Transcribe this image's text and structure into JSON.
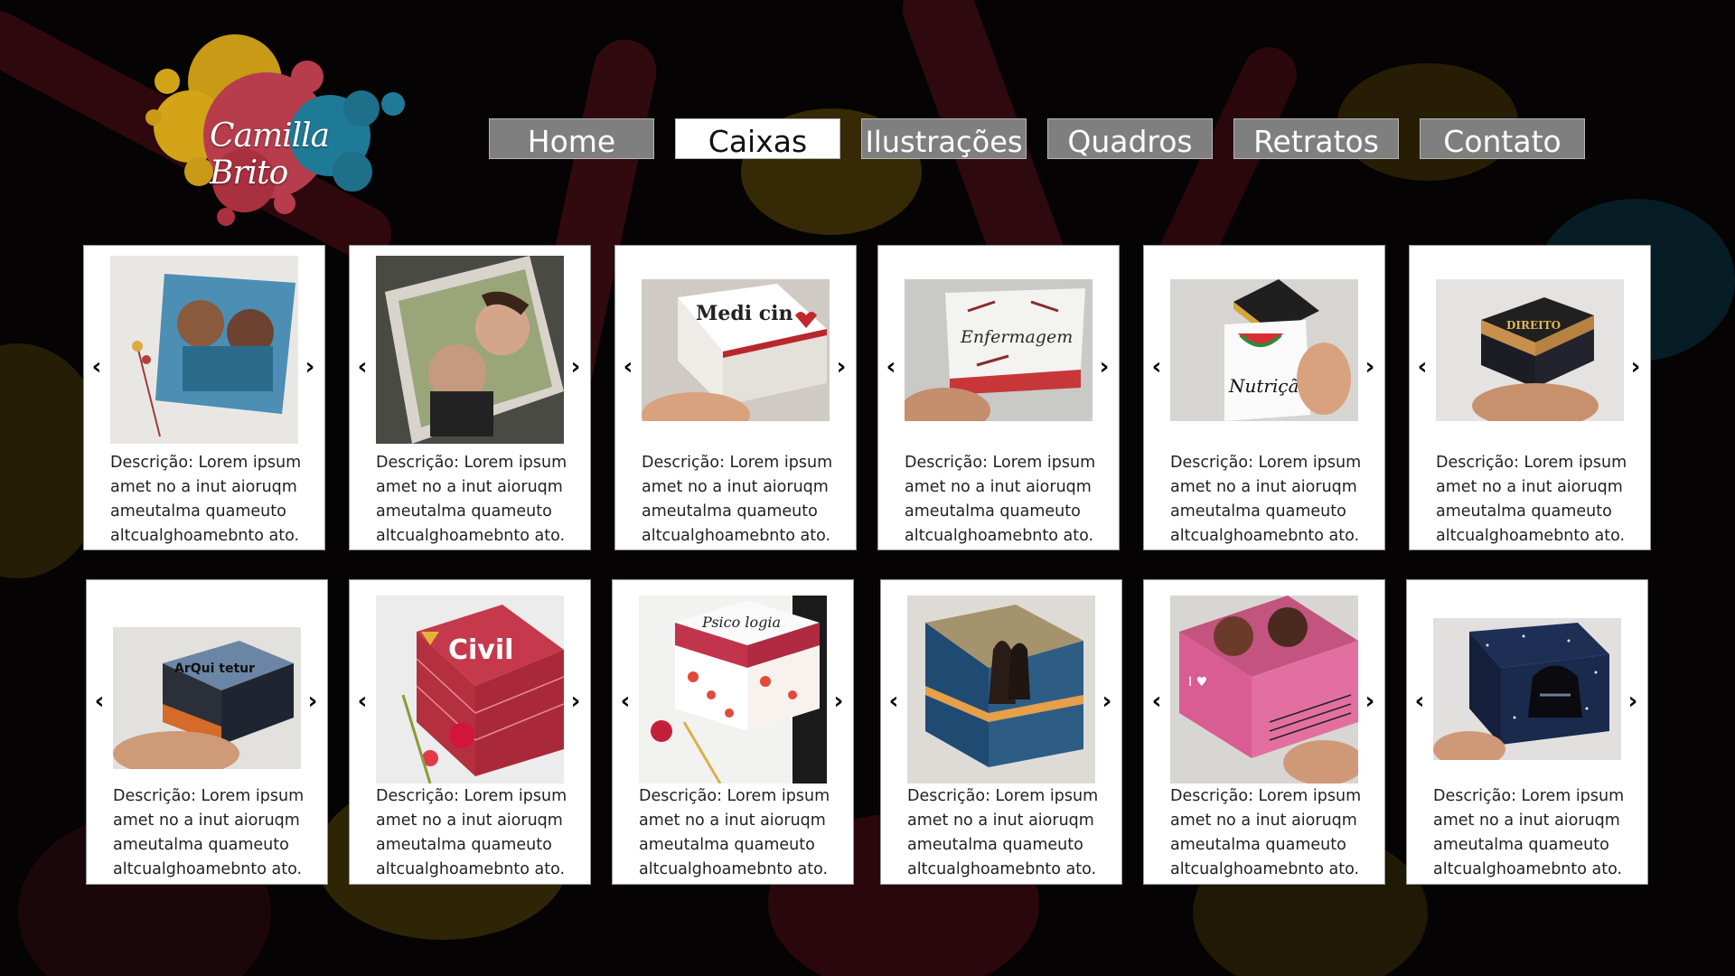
{
  "logo": {
    "text": "Camilla Brito"
  },
  "nav": {
    "items": [
      {
        "label": "Home",
        "active": false
      },
      {
        "label": "Caixas",
        "active": true
      },
      {
        "label": "Ilustrações",
        "active": false
      },
      {
        "label": "Quadros",
        "active": false
      },
      {
        "label": "Retratos",
        "active": false
      },
      {
        "label": "Contato",
        "active": false
      }
    ]
  },
  "carousel": {
    "prev_icon": "chevron-left-icon",
    "next_icon": "chevron-right-icon",
    "prev_glyph": "‹",
    "next_glyph": "›"
  },
  "cards": [
    {
      "description": "Descrição: Lorem ipsum amet no a inut aioruqm ameutalma quameuto altcualghoamebnto ato.",
      "image_text": ""
    },
    {
      "description": "Descrição: Lorem ipsum amet no a inut aioruqm ameutalma quameuto altcualghoamebnto ato.",
      "image_text": ""
    },
    {
      "description": "Descrição: Lorem ipsum amet no a inut aioruqm ameutalma quameuto altcualghoamebnto ato.",
      "image_text": "Medi cin"
    },
    {
      "description": "Descrição: Lorem ipsum amet no a inut aioruqm ameutalma quameuto altcualghoamebnto ato.",
      "image_text": "Enfermagem"
    },
    {
      "description": "Descrição: Lorem ipsum amet no a inut aioruqm ameutalma quameuto altcualghoamebnto ato.",
      "image_text": "Nutrição"
    },
    {
      "description": "Descrição: Lorem ipsum amet no a inut aioruqm ameutalma quameuto altcualghoamebnto ato.",
      "image_text": "DIREITO"
    },
    {
      "description": "Descrição: Lorem ipsum amet no a inut aioruqm ameutalma quameuto altcualghoamebnto ato.",
      "image_text": "ArQui tetur"
    },
    {
      "description": "Descrição: Lorem ipsum amet no a inut aioruqm ameutalma quameuto altcualghoamebnto ato.",
      "image_text": "Civil"
    },
    {
      "description": "Descrição: Lorem ipsum amet no a inut aioruqm ameutalma quameuto altcualghoamebnto ato.",
      "image_text": "Psico logia"
    },
    {
      "description": "Descrição: Lorem ipsum amet no a inut aioruqm ameutalma quameuto altcualghoamebnto ato.",
      "image_text": ""
    },
    {
      "description": "Descrição: Lorem ipsum amet no a inut aioruqm ameutalma quameuto altcualghoamebnto ato.",
      "image_text": ""
    },
    {
      "description": "Descrição: Lorem ipsum amet no a inut aioruqm ameutalma quameuto altcualghoamebnto ato.",
      "image_text": ""
    }
  ]
}
